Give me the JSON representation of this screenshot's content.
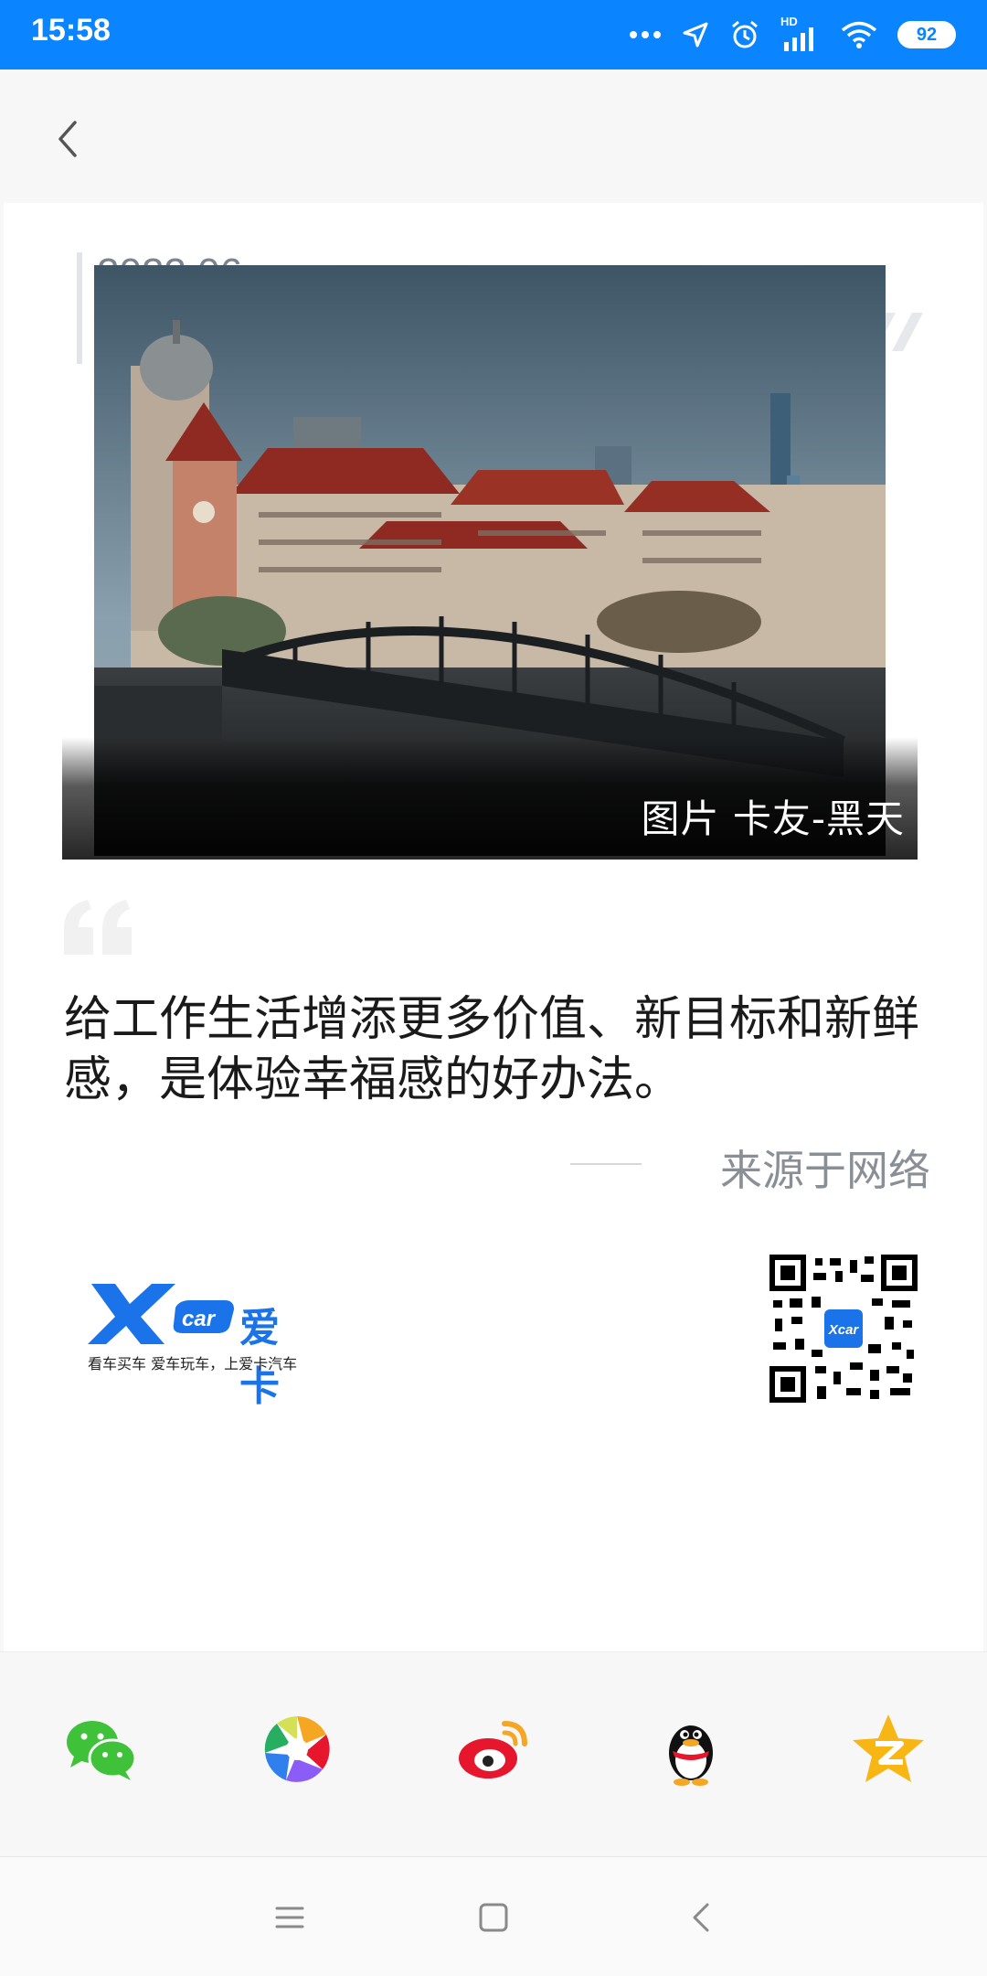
{
  "status_bar": {
    "time": "15:58",
    "signal_badge": "HD",
    "battery": "92"
  },
  "header": {
    "back_icon": "chevron-left-icon"
  },
  "card": {
    "date_year_month": "2022.06",
    "date_day": "26",
    "photo_caption": "图片 卡友-黑天",
    "quote": "给工作生活增添更多价值、新目标和新鲜感，是体验幸福感的好办法。",
    "source": "来源于网络",
    "logo_text": "爱卡",
    "tagline": "看车买车 爱车玩车，上爱卡汽车"
  },
  "share": {
    "items": [
      {
        "name": "wechat",
        "icon": "wechat-icon"
      },
      {
        "name": "moments",
        "icon": "moments-icon"
      },
      {
        "name": "weibo",
        "icon": "weibo-icon"
      },
      {
        "name": "qq",
        "icon": "qq-icon"
      },
      {
        "name": "qzone",
        "icon": "qzone-icon"
      }
    ]
  },
  "colors": {
    "status_bar": "#0a84ff",
    "wechat": "#3fc23a",
    "weibo": "#e6162d",
    "qzone": "#f7b614",
    "brand_blue": "#1a73e8"
  }
}
